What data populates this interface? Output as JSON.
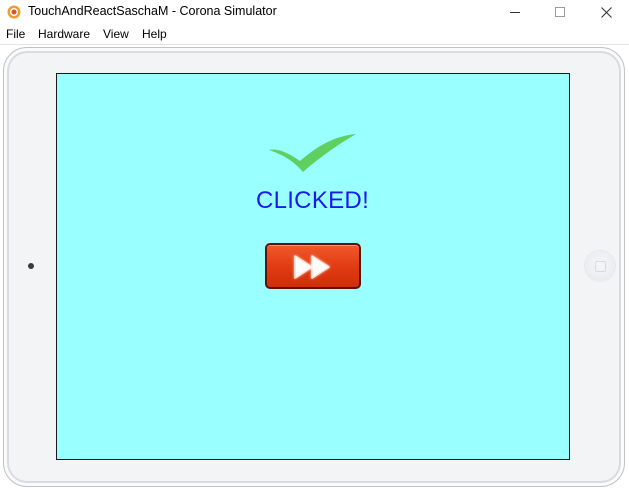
{
  "window": {
    "title": "TouchAndReactSaschaM - Corona Simulator",
    "icon": "corona-app-icon",
    "controls": [
      "minimize-icon",
      "maximize-icon",
      "close-icon"
    ]
  },
  "menu": {
    "items": [
      "File",
      "Hardware",
      "View",
      "Help"
    ]
  },
  "device": {
    "type": "tablet-skin",
    "screen_color": "#99ffff"
  },
  "app": {
    "status_text": "CLICKED!",
    "status_color": "#1a1aee",
    "checkmark_icon": "checkmark-icon",
    "checkmark_color": "#5fcf5f",
    "button": {
      "icon": "fast-forward-icon",
      "color": "#e03a12"
    }
  }
}
